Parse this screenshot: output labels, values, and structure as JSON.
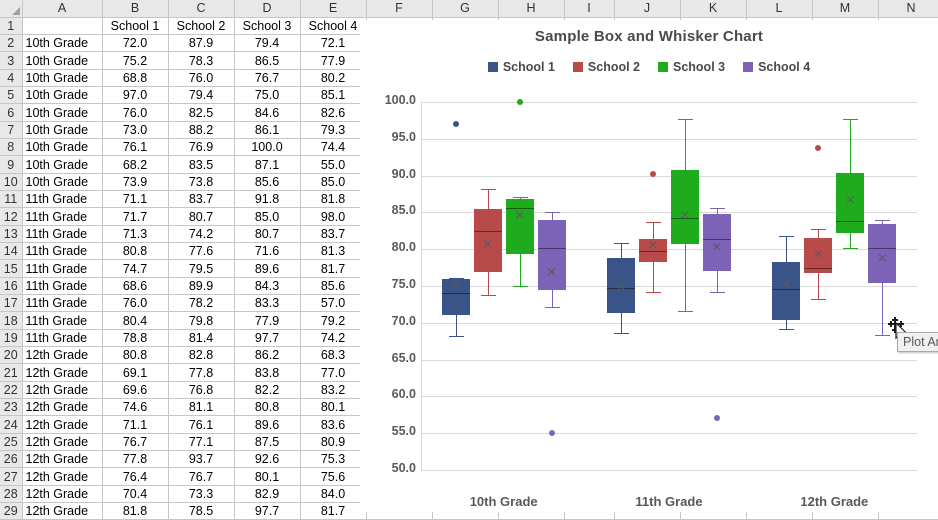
{
  "spreadsheet": {
    "column_headers": [
      "A",
      "B",
      "C",
      "D",
      "E",
      "F",
      "G",
      "H",
      "I",
      "J",
      "K",
      "L",
      "M",
      "N"
    ],
    "header_row": {
      "a": "",
      "b": "School 1",
      "c": "School 2",
      "d": "School 3",
      "e": "School 4"
    },
    "rows": [
      {
        "n": "1",
        "a": "",
        "b": "",
        "c": "",
        "d": "",
        "e": "",
        "bold": false,
        "header": true
      },
      {
        "n": "2",
        "a": "10th Grade",
        "b": "72.0",
        "c": "87.9",
        "d": "79.4",
        "e": "72.1",
        "bold": true
      },
      {
        "n": "3",
        "a": "10th Grade",
        "b": "75.2",
        "c": "78.3",
        "d": "86.5",
        "e": "77.9",
        "bold": false
      },
      {
        "n": "4",
        "a": "10th Grade",
        "b": "68.8",
        "c": "76.0",
        "d": "76.7",
        "e": "80.2",
        "bold": false
      },
      {
        "n": "5",
        "a": "10th Grade",
        "b": "97.0",
        "c": "79.4",
        "d": "75.0",
        "e": "85.1",
        "bold": false
      },
      {
        "n": "6",
        "a": "10th Grade",
        "b": "76.0",
        "c": "82.5",
        "d": "84.6",
        "e": "82.6",
        "bold": false
      },
      {
        "n": "7",
        "a": "10th Grade",
        "b": "73.0",
        "c": "88.2",
        "d": "86.1",
        "e": "79.3",
        "bold": false
      },
      {
        "n": "8",
        "a": "10th Grade",
        "b": "76.1",
        "c": "76.9",
        "d": "100.0",
        "e": "74.4",
        "bold": false
      },
      {
        "n": "9",
        "a": "10th Grade",
        "b": "68.2",
        "c": "83.5",
        "d": "87.1",
        "e": "55.0",
        "bold": false
      },
      {
        "n": "10",
        "a": "10th Grade",
        "b": "73.9",
        "c": "73.8",
        "d": "85.6",
        "e": "85.0",
        "bold": false
      },
      {
        "n": "11",
        "a": "11th Grade",
        "b": "71.1",
        "c": "83.7",
        "d": "91.8",
        "e": "81.8",
        "bold": true
      },
      {
        "n": "12",
        "a": "11th Grade",
        "b": "71.7",
        "c": "80.7",
        "d": "85.0",
        "e": "98.0",
        "bold": false
      },
      {
        "n": "13",
        "a": "11th Grade",
        "b": "71.3",
        "c": "74.2",
        "d": "80.7",
        "e": "83.7",
        "bold": false
      },
      {
        "n": "14",
        "a": "11th Grade",
        "b": "80.8",
        "c": "77.6",
        "d": "71.6",
        "e": "81.3",
        "bold": false
      },
      {
        "n": "15",
        "a": "11th Grade",
        "b": "74.7",
        "c": "79.5",
        "d": "89.6",
        "e": "81.7",
        "bold": false
      },
      {
        "n": "16",
        "a": "11th Grade",
        "b": "68.6",
        "c": "89.9",
        "d": "84.3",
        "e": "85.6",
        "bold": false
      },
      {
        "n": "17",
        "a": "11th Grade",
        "b": "76.0",
        "c": "78.2",
        "d": "83.3",
        "e": "57.0",
        "bold": false
      },
      {
        "n": "18",
        "a": "11th Grade",
        "b": "80.4",
        "c": "79.8",
        "d": "77.9",
        "e": "79.2",
        "bold": false
      },
      {
        "n": "19",
        "a": "11th Grade",
        "b": "78.8",
        "c": "81.4",
        "d": "97.7",
        "e": "74.2",
        "bold": false
      },
      {
        "n": "20",
        "a": "12th Grade",
        "b": "80.8",
        "c": "82.8",
        "d": "86.2",
        "e": "68.3",
        "bold": true
      },
      {
        "n": "21",
        "a": "12th Grade",
        "b": "69.1",
        "c": "77.8",
        "d": "83.8",
        "e": "77.0",
        "bold": false
      },
      {
        "n": "22",
        "a": "12th Grade",
        "b": "69.6",
        "c": "76.8",
        "d": "82.2",
        "e": "83.2",
        "bold": false
      },
      {
        "n": "23",
        "a": "12th Grade",
        "b": "74.6",
        "c": "81.1",
        "d": "80.8",
        "e": "80.1",
        "bold": false
      },
      {
        "n": "24",
        "a": "12th Grade",
        "b": "71.1",
        "c": "76.1",
        "d": "89.6",
        "e": "83.6",
        "bold": false
      },
      {
        "n": "25",
        "a": "12th Grade",
        "b": "76.7",
        "c": "77.1",
        "d": "87.5",
        "e": "80.9",
        "bold": false
      },
      {
        "n": "26",
        "a": "12th Grade",
        "b": "77.8",
        "c": "93.7",
        "d": "92.6",
        "e": "75.3",
        "bold": false
      },
      {
        "n": "27",
        "a": "12th Grade",
        "b": "76.4",
        "c": "76.7",
        "d": "80.1",
        "e": "75.6",
        "bold": false
      },
      {
        "n": "28",
        "a": "12th Grade",
        "b": "70.4",
        "c": "73.3",
        "d": "82.9",
        "e": "84.0",
        "bold": false
      },
      {
        "n": "29",
        "a": "12th Grade",
        "b": "81.8",
        "c": "78.5",
        "d": "97.7",
        "e": "81.7",
        "bold": false
      }
    ]
  },
  "chart_data": {
    "type": "box",
    "title": "Sample Box and Whisker Chart",
    "xlabel": "",
    "ylabel": "",
    "ylim": [
      50.0,
      100.0
    ],
    "ytick_step": 5.0,
    "yticks": [
      "100.0",
      "95.0",
      "90.0",
      "85.0",
      "80.0",
      "75.0",
      "70.0",
      "65.0",
      "60.0",
      "55.0",
      "50.0"
    ],
    "categories": [
      "10th Grade",
      "11th Grade",
      "12th Grade"
    ],
    "grid": true,
    "legend_position": "top",
    "legend": [
      {
        "name": "School 1",
        "color": "#3b5488"
      },
      {
        "name": "School 2",
        "color": "#b94a4a"
      },
      {
        "name": "School 3",
        "color": "#1eab1e"
      },
      {
        "name": "School 4",
        "color": "#7c63b8"
      }
    ],
    "series": [
      {
        "name": "School 1",
        "color": "#3b5488",
        "boxes": [
          {
            "category": "10th Grade",
            "min": 68.2,
            "q1": 71.0,
            "median": 74.0,
            "q3": 76.0,
            "max": 76.1,
            "mean": 75.1,
            "outliers": [
              97.0
            ]
          },
          {
            "category": "11th Grade",
            "min": 68.6,
            "q1": 71.3,
            "median": 74.7,
            "q3": 78.8,
            "max": 80.8,
            "mean": 74.8,
            "outliers": []
          },
          {
            "category": "12th Grade",
            "min": 69.1,
            "q1": 70.4,
            "median": 74.6,
            "q3": 78.3,
            "max": 81.8,
            "mean": 75.3,
            "outliers": []
          }
        ]
      },
      {
        "name": "School 2",
        "color": "#b94a4a",
        "boxes": [
          {
            "category": "10th Grade",
            "min": 73.8,
            "q1": 76.9,
            "median": 82.5,
            "q3": 85.5,
            "max": 88.2,
            "mean": 80.7,
            "outliers": []
          },
          {
            "category": "11th Grade",
            "min": 74.2,
            "q1": 78.2,
            "median": 79.8,
            "q3": 81.4,
            "max": 83.7,
            "mean": 80.6,
            "outliers": [
              90.2
            ]
          },
          {
            "category": "12th Grade",
            "min": 73.3,
            "q1": 76.7,
            "median": 77.4,
            "q3": 81.5,
            "max": 82.8,
            "mean": 79.4,
            "outliers": [
              93.7
            ]
          }
        ]
      },
      {
        "name": "School 3",
        "color": "#1eab1e",
        "boxes": [
          {
            "category": "10th Grade",
            "min": 75.0,
            "q1": 79.4,
            "median": 85.6,
            "q3": 86.8,
            "max": 87.1,
            "mean": 84.6,
            "outliers": [
              100.0
            ]
          },
          {
            "category": "11th Grade",
            "min": 71.6,
            "q1": 80.7,
            "median": 84.3,
            "q3": 90.7,
            "max": 97.7,
            "mean": 84.7,
            "outliers": []
          },
          {
            "category": "12th Grade",
            "min": 80.1,
            "q1": 82.2,
            "median": 83.8,
            "q3": 90.3,
            "max": 97.7,
            "mean": 86.7,
            "outliers": []
          }
        ]
      },
      {
        "name": "School 4",
        "color": "#7c63b8",
        "boxes": [
          {
            "category": "10th Grade",
            "min": 72.1,
            "q1": 74.4,
            "median": 80.2,
            "q3": 84.0,
            "max": 85.1,
            "mean": 76.9,
            "outliers": [
              55.0
            ]
          },
          {
            "category": "11th Grade",
            "min": 74.2,
            "q1": 77.0,
            "median": 81.4,
            "q3": 84.8,
            "max": 85.6,
            "mean": 80.3,
            "outliers": [
              57.0
            ]
          },
          {
            "category": "12th Grade",
            "min": 68.3,
            "q1": 75.4,
            "median": 80.1,
            "q3": 83.4,
            "max": 84.0,
            "mean": 78.8,
            "outliers": []
          }
        ]
      }
    ]
  },
  "tooltip": {
    "text": "Plot Ar"
  }
}
